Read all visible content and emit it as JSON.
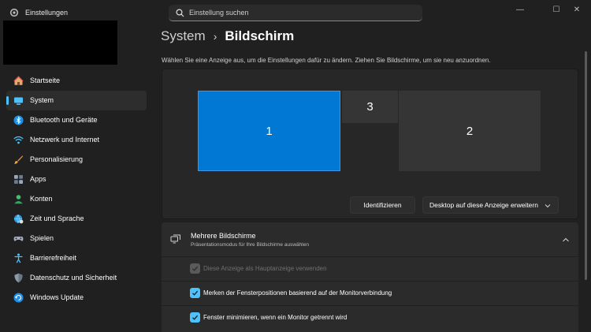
{
  "window": {
    "title": "Einstellungen",
    "controls": {
      "minimize": "—",
      "maximize": "☐",
      "close": "✕"
    }
  },
  "search": {
    "placeholder": "Einstellung suchen",
    "value": ""
  },
  "sidebar": {
    "selected_index": 1,
    "items": [
      {
        "label": "Startseite",
        "icon": "home-icon"
      },
      {
        "label": "System",
        "icon": "system-monitor-icon"
      },
      {
        "label": "Bluetooth und Geräte",
        "icon": "bluetooth-icon"
      },
      {
        "label": "Netzwerk und Internet",
        "icon": "wifi-icon"
      },
      {
        "label": "Personalisierung",
        "icon": "brush-icon"
      },
      {
        "label": "Apps",
        "icon": "apps-icon"
      },
      {
        "label": "Konten",
        "icon": "account-icon"
      },
      {
        "label": "Zeit und Sprache",
        "icon": "globe-clock-icon"
      },
      {
        "label": "Spielen",
        "icon": "gamepad-icon"
      },
      {
        "label": "Barrierefreiheit",
        "icon": "accessibility-icon"
      },
      {
        "label": "Datenschutz und Sicherheit",
        "icon": "shield-icon"
      },
      {
        "label": "Windows Update",
        "icon": "update-icon"
      }
    ]
  },
  "breadcrumb": {
    "parent": "System",
    "separator": "›",
    "current": "Bildschirm"
  },
  "description": "Wählen Sie eine Anzeige aus, um die Einstellungen dafür zu ändern. Ziehen Sie Bildschirme, um sie neu anzuordnen.",
  "arrangement": {
    "monitors": [
      {
        "label": "1",
        "selected": true
      },
      {
        "label": "3",
        "selected": false
      },
      {
        "label": "2",
        "selected": false
      }
    ],
    "identify_button": "Identifizieren",
    "extend_dropdown": "Desktop auf diese Anzeige erweitern"
  },
  "multiple_displays": {
    "title": "Mehrere Bildschirme",
    "subtitle": "Präsentationsmodus für Ihre Bildschirme auswählen",
    "expanded": true,
    "options": [
      {
        "label": "Diese Anzeige als Hauptanzeige verwenden",
        "checked": true,
        "disabled": true
      },
      {
        "label": "Merken der Fensterpositionen basierend auf der Monitorverbindung",
        "checked": true,
        "disabled": false
      },
      {
        "label": "Fenster minimieren, wenn ein Monitor getrennt wird",
        "checked": true,
        "disabled": false
      }
    ]
  },
  "colors": {
    "accent": "#4cc2ff",
    "selected_monitor": "#0078d4",
    "background": "#202020",
    "card": "#2b2b2b"
  }
}
